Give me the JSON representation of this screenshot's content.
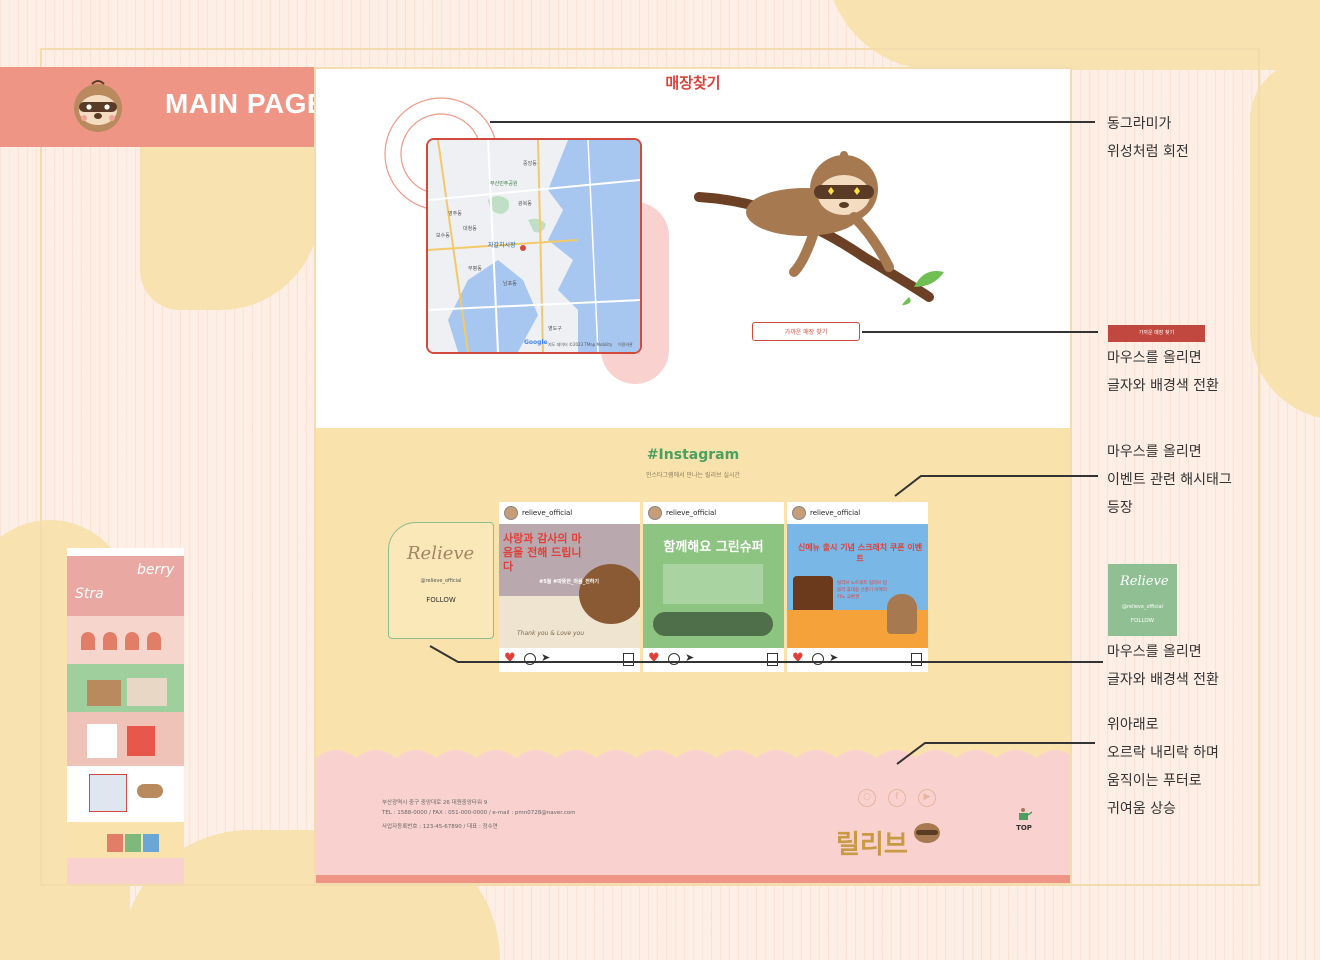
{
  "header": {
    "title": "MAIN PAGE"
  },
  "store": {
    "title": "매장찾기",
    "map_copyright": "지도 데이터 ©2023 TMap Mobility",
    "map_terms": "이용약관",
    "map_brand": "Google",
    "find_button": "가까운 매장 찾기",
    "map_labels": [
      "부산민주공원",
      "자갈치시장",
      "부평동",
      "남포동",
      "영주동",
      "대청동",
      "보수동",
      "광복동",
      "중앙동",
      "영도구"
    ]
  },
  "instagram": {
    "title": "#Instagram",
    "subtitle": "인스타그램에서 만나는 릴리브 실시간",
    "follow": {
      "logo": "Relieve",
      "handle": "@relieve_official",
      "label": "FOLLOW"
    },
    "posts": [
      {
        "user": "relieve_official",
        "headline": "사랑과 감사의 마음을 전해 드립니다",
        "tag": "#5월 #따뜻한_마음_전하기",
        "script": "Thank you & Love you"
      },
      {
        "user": "relieve_official",
        "headline": "함께해요 그린슈퍼"
      },
      {
        "user": "relieve_official",
        "headline": "신메뉴 출시 기념 스크래치 쿠폰 이벤트",
        "sub": "릴리브 노트세트 릴리브 텀블러 휴대용 선풍기 아메리카노 교환권"
      }
    ]
  },
  "footer": {
    "address": "부산광역시 중구 중앙대로 26 대원중앙타워 9",
    "contact": "TEL : 1588-0000 / FAX : 051-000-0000 / e-mail : pmn0728@naver.com",
    "biz": "사업자등록번호 : 123-45-67890 / 대표 : 정수연",
    "logo": "릴리브",
    "top_label": "TOP",
    "social": [
      "instagram-icon",
      "facebook-icon",
      "youtube-icon"
    ]
  },
  "annotations": {
    "orbit": [
      "동그라미가",
      "위성처럼 회전"
    ],
    "hover_button": [
      "마우스를 올리면",
      "글자와 배경색 전환"
    ],
    "hover_post": [
      "마우스를 올리면",
      "이벤트 관련 해시태그",
      "등장"
    ],
    "hover_follow": [
      "마우스를 올리면",
      "글자와 배경색 전환"
    ],
    "footer_wave": [
      "위아래로",
      "오르락 내리락 하며",
      "움직이는 푸터로",
      "귀여움 상승"
    ],
    "badge_label": "가까운 매장 찾기",
    "follow_handle": "@relieve_official",
    "follow_label": "FOLLOW",
    "follow_logo": "Relieve"
  },
  "colors": {
    "accent": "#ef9585",
    "red": "#d14a3d",
    "yellow": "#f9e2ac",
    "green": "#4aa060",
    "pink": "#f9d2cf"
  }
}
